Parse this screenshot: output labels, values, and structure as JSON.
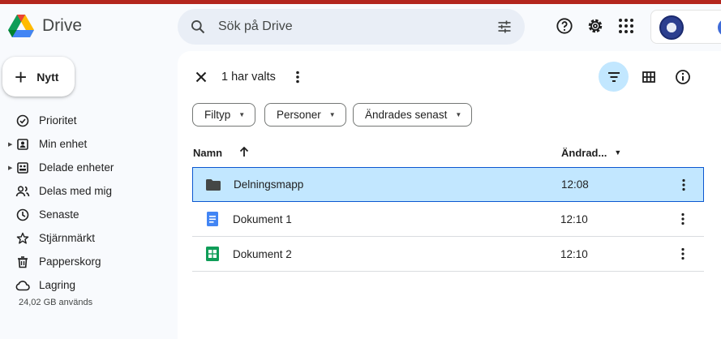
{
  "app": {
    "name": "Drive"
  },
  "search": {
    "placeholder": "Sök på Drive"
  },
  "new_button": {
    "label": "Nytt"
  },
  "sidebar": {
    "items": [
      {
        "label": "Prioritet",
        "icon": "priority-check-icon"
      },
      {
        "label": "Min enhet",
        "icon": "my-drive-icon",
        "expandable": true
      },
      {
        "label": "Delade enheter",
        "icon": "shared-drives-icon",
        "expandable": true
      },
      {
        "label": "Delas med mig",
        "icon": "people-icon"
      },
      {
        "label": "Senaste",
        "icon": "clock-icon"
      },
      {
        "label": "Stjärnmärkt",
        "icon": "star-icon"
      },
      {
        "label": "Papperskorg",
        "icon": "trash-icon"
      },
      {
        "label": "Lagring",
        "icon": "cloud-icon"
      }
    ],
    "storage_text": "24,02 GB används"
  },
  "selection": {
    "count_label": "1 har valts"
  },
  "filters": [
    {
      "label": "Filtyp"
    },
    {
      "label": "Personer"
    },
    {
      "label": "Ändrades senast"
    }
  ],
  "columns": {
    "name": "Namn",
    "modified": "Ändrad..."
  },
  "files": [
    {
      "name": "Delningsmapp",
      "time": "12:08",
      "type": "folder",
      "selected": true
    },
    {
      "name": "Dokument 1",
      "time": "12:10",
      "type": "doc",
      "selected": false
    },
    {
      "name": "Dokument 2",
      "time": "12:10",
      "type": "sheet",
      "selected": false
    }
  ],
  "colors": {
    "accent": "#0b57d0",
    "selected_bg": "#c2e7ff",
    "header_red": "#b3261e"
  }
}
